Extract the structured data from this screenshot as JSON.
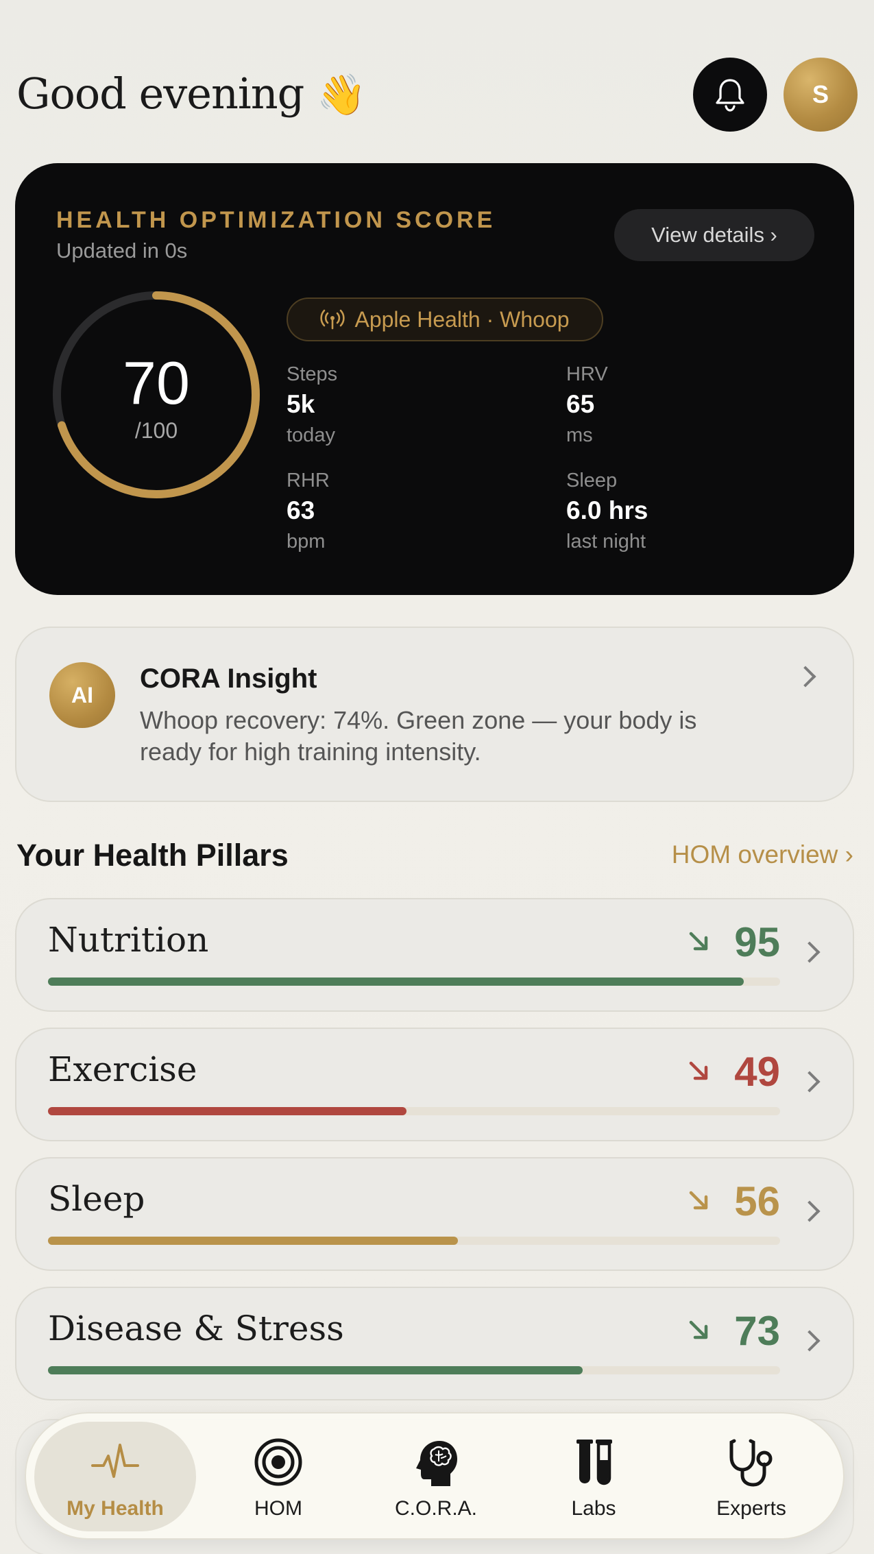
{
  "header": {
    "greeting": "Good evening",
    "greeting_emoji": "👋",
    "avatar_initial": "S",
    "bell_icon": "bell-icon"
  },
  "score": {
    "title": "HEALTH OPTIMIZATION SCORE",
    "updated": "Updated in 0s",
    "view_details": "View details ›",
    "value": "70",
    "max": "/100",
    "fraction": 0.7,
    "source": "Apple Health · Whoop",
    "metrics": [
      {
        "label": "Steps",
        "value": "5k",
        "unit": "today"
      },
      {
        "label": "HRV",
        "value": "65",
        "unit": "ms"
      },
      {
        "label": "RHR",
        "value": "63",
        "unit": "bpm"
      },
      {
        "label": "Sleep",
        "value": "6.0 hrs",
        "unit": "last night"
      }
    ]
  },
  "insight": {
    "badge": "AI",
    "title": "CORA Insight",
    "text": "Whoop recovery: 74%. Green zone — your body is ready for high training intensity."
  },
  "pillars_section": {
    "title": "Your Health Pillars",
    "link": "HOM overview ›",
    "items": [
      {
        "name": "Nutrition",
        "score": "95",
        "progress": 0.95,
        "color": "#4e7d59"
      },
      {
        "name": "Exercise",
        "score": "49",
        "progress": 0.49,
        "color": "#b0473f"
      },
      {
        "name": "Sleep",
        "score": "56",
        "progress": 0.56,
        "color": "#b9934b"
      },
      {
        "name": "Disease & Stress",
        "score": "73",
        "progress": 0.73,
        "color": "#4e7d59"
      }
    ]
  },
  "colors": {
    "gold": "#c1964d",
    "green": "#4e7d59",
    "red": "#b0473f",
    "dark": "#0b0b0c"
  },
  "tabs": [
    {
      "label": "My Health",
      "icon": "heartbeat-icon",
      "active": true
    },
    {
      "label": "HOM",
      "icon": "target-icon",
      "active": false
    },
    {
      "label": "C.O.R.A.",
      "icon": "brain-head-icon",
      "active": false
    },
    {
      "label": "Labs",
      "icon": "test-tubes-icon",
      "active": false
    },
    {
      "label": "Experts",
      "icon": "stethoscope-icon",
      "active": false
    }
  ]
}
